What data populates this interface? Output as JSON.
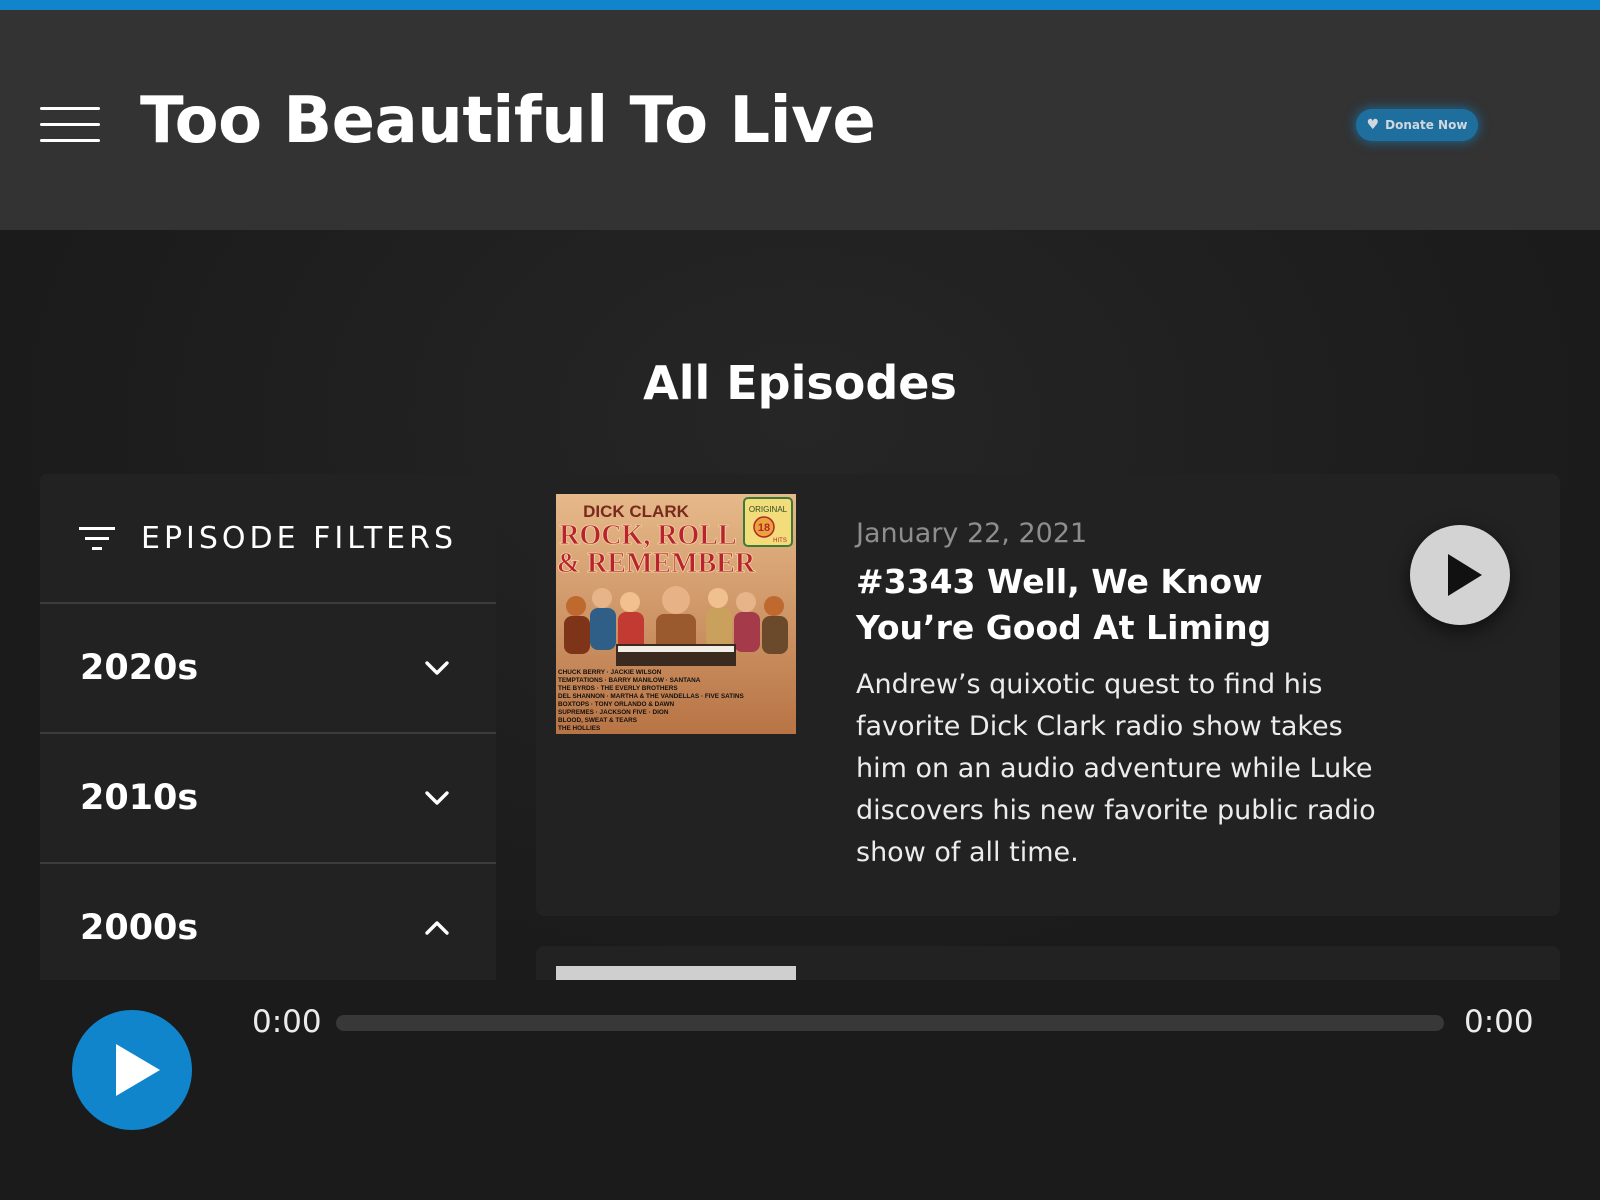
{
  "colors": {
    "accent": "#1185cc",
    "header_bg": "#333333",
    "page_bg": "#1b1b1b",
    "card_bg": "#222222"
  },
  "header": {
    "menu_icon": "hamburger-menu-icon",
    "site_title": "Too Beautiful To Live",
    "donate_icon": "heart-icon",
    "donate_label": "Donate Now"
  },
  "page_title": "All Episodes",
  "filters": {
    "icon": "filter-icon",
    "heading": "EPISODE FILTERS",
    "decades": [
      {
        "label": "2020s",
        "expanded": false,
        "icon": "chevron-down-icon"
      },
      {
        "label": "2010s",
        "expanded": false,
        "icon": "chevron-down-icon"
      },
      {
        "label": "2000s",
        "expanded": true,
        "icon": "chevron-up-icon"
      }
    ]
  },
  "episodes": [
    {
      "date": "January 22, 2021",
      "title": "#3343 Well, We Know You’re Good At Liming",
      "description": "Andrew’s quixotic quest to find his favorite Dick Clark radio show takes him on an audio adventure while Luke discovers his new favorite public radio show of all time.",
      "play_icon": "play-icon",
      "cover": {
        "brand": "DICK CLARK",
        "line1": "ROCK, ROLL",
        "line2": "& REMEMBER",
        "badge_top": "ORIGINAL",
        "badge_num": "18",
        "badge_bottom": "HITS",
        "artists": [
          "CHUCK BERRY · JACKIE WILSON",
          "TEMPTATIONS · BARRY MANILOW · SANTANA",
          "THE BYRDS · THE EVERLY BROTHERS",
          "DEL SHANNON · MARTHA & THE VANDELLAS · FIVE SATINS",
          "BOXTOPS · TONY ORLANDO & DAWN",
          "SUPREMES · JACKSON FIVE · DION",
          "BLOOD, SWEAT & TEARS",
          "THE HOLLIES"
        ]
      }
    }
  ],
  "player": {
    "play_icon": "play-icon",
    "current_time": "0:00",
    "duration": "0:00",
    "progress": 0
  }
}
